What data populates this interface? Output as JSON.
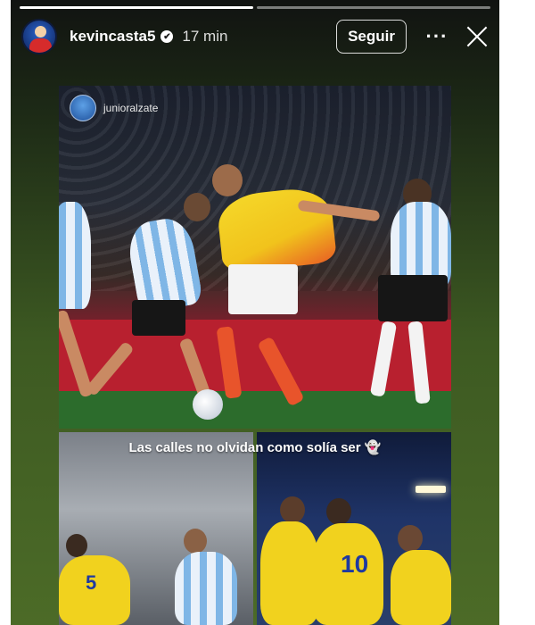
{
  "story": {
    "progress_segments": 2,
    "active_segment": 0,
    "username": "kevincasta5",
    "verified_mark": "✔",
    "time_ago": "17 min",
    "follow_label": "Seguir",
    "more_label": "···",
    "background_colors": [
      "#111311",
      "#4c6b27"
    ]
  },
  "post": {
    "tagged_user": "junioralzate",
    "caption": "Las calles no olvidan como solía ser 👻",
    "jersey_numbers": [
      "5",
      "10"
    ]
  }
}
